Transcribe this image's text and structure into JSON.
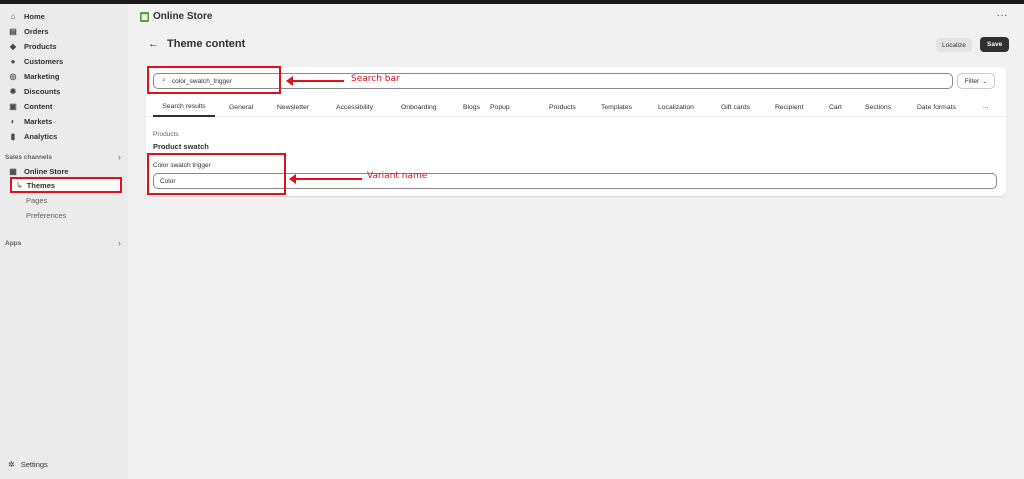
{
  "topbar": {},
  "sidebar": {
    "nav": [
      {
        "label": "Home",
        "icon": "home-icon",
        "glyph": "⌂"
      },
      {
        "label": "Orders",
        "icon": "inbox-icon",
        "glyph": "▤"
      },
      {
        "label": "Products",
        "icon": "tag-icon",
        "glyph": "◆"
      },
      {
        "label": "Customers",
        "icon": "person-icon",
        "glyph": "●"
      },
      {
        "label": "Marketing",
        "icon": "target-icon",
        "glyph": "◎"
      },
      {
        "label": "Discounts",
        "icon": "discount-icon",
        "glyph": "✹"
      },
      {
        "label": "Content",
        "icon": "content-icon",
        "glyph": "▣"
      },
      {
        "label": "Markets",
        "icon": "globe-icon",
        "glyph": "◐"
      },
      {
        "label": "Analytics",
        "icon": "bar-chart-icon",
        "glyph": "▮"
      }
    ],
    "sales_channels_label": "Sales channels",
    "online_store": {
      "label": "Online Store",
      "icon": "store-icon",
      "glyph": "▦"
    },
    "themes": "Themes",
    "pages": "Pages",
    "preferences": "Preferences",
    "apps_label": "Apps",
    "settings": "Settings"
  },
  "header": {
    "store_name": "Online Store",
    "more": "···"
  },
  "page": {
    "title": "Theme content",
    "back": "←",
    "localize": "Localize",
    "save": "Save"
  },
  "search": {
    "value": "color_swatch_trigger",
    "filter": "Filter"
  },
  "tabs": [
    "Search results",
    "General",
    "Newsletter",
    "Accessibility",
    "Onboarding",
    "Blogs",
    "Popup",
    "Products",
    "Templates",
    "Localization",
    "Gift cards",
    "Recipient",
    "Cart",
    "Sections",
    "Date formats",
    "···"
  ],
  "result": {
    "group": "Products",
    "title": "Product swatch",
    "field_label": "Color swatch trigger",
    "field_value": "Color"
  },
  "annotations": {
    "search_bar": "Search bar",
    "variant_name": "Variant name",
    "color": "#e0101d"
  },
  "colors": {
    "primary_button": "#303030",
    "annotation_red": "#e0101d",
    "sidebar_bg": "#ebebeb"
  }
}
